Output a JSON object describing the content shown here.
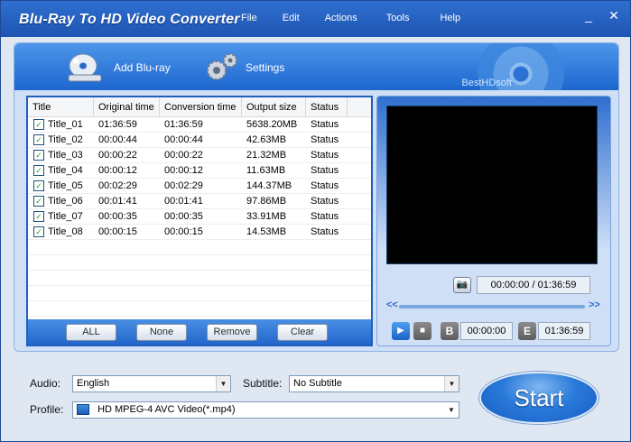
{
  "app": {
    "title": "Blu-Ray To HD Video Converter"
  },
  "menu": [
    "File",
    "Edit",
    "Actions",
    "Tools",
    "Help"
  ],
  "window_buttons": {
    "minimize": "_",
    "close": "✕"
  },
  "toolbar": {
    "add_bluray": "Add Blu-ray",
    "settings": "Settings",
    "brand": "BestHDsoft"
  },
  "table": {
    "headers": [
      "Title",
      "Original time",
      "Conversion time",
      "Output size",
      "Status"
    ],
    "rows": [
      {
        "title": "Title_01",
        "original": "01:36:59",
        "conversion": "01:36:59",
        "size": "5638.20MB",
        "status": "Status",
        "checked": true
      },
      {
        "title": "Title_02",
        "original": "00:00:44",
        "conversion": "00:00:44",
        "size": "42.63MB",
        "status": "Status",
        "checked": true
      },
      {
        "title": "Title_03",
        "original": "00:00:22",
        "conversion": "00:00:22",
        "size": "21.32MB",
        "status": "Status",
        "checked": true
      },
      {
        "title": "Title_04",
        "original": "00:00:12",
        "conversion": "00:00:12",
        "size": "11.63MB",
        "status": "Status",
        "checked": true
      },
      {
        "title": "Title_05",
        "original": "00:02:29",
        "conversion": "00:02:29",
        "size": "144.37MB",
        "status": "Status",
        "checked": true
      },
      {
        "title": "Title_06",
        "original": "00:01:41",
        "conversion": "00:01:41",
        "size": "97.86MB",
        "status": "Status",
        "checked": true
      },
      {
        "title": "Title_07",
        "original": "00:00:35",
        "conversion": "00:00:35",
        "size": "33.91MB",
        "status": "Status",
        "checked": true
      },
      {
        "title": "Title_08",
        "original": "00:00:15",
        "conversion": "00:00:15",
        "size": "14.53MB",
        "status": "Status",
        "checked": true
      }
    ]
  },
  "list_buttons": {
    "all": "ALL",
    "none": "None",
    "remove": "Remove",
    "clear": "Clear"
  },
  "preview": {
    "current_time": "00:00:00",
    "separator": "/",
    "total_time": "01:36:59",
    "seek_left": "<<",
    "seek_right": ">>",
    "begin_label": "B",
    "begin_time": "00:00:00",
    "end_label": "E",
    "end_time": "01:36:59"
  },
  "settings": {
    "audio_label": "Audio:",
    "audio_value": "English",
    "subtitle_label": "Subtitle:",
    "subtitle_value": "No Subtitle",
    "profile_label": "Profile:",
    "profile_value": "HD MPEG-4 AVC Video(*.mp4)"
  },
  "start_button": "Start",
  "colors": {
    "accent": "#1f5fbe",
    "titlebar": "#2b5fb6",
    "panel": "#cfe0f6"
  }
}
